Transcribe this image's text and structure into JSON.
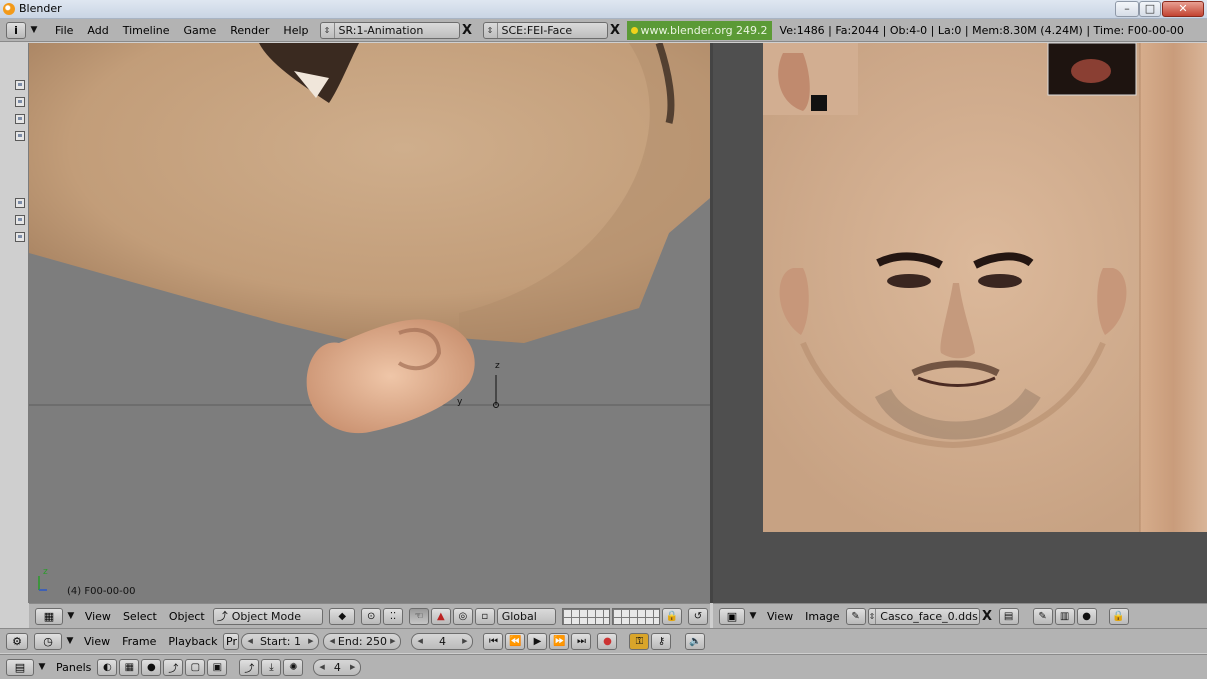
{
  "window": {
    "title": "Blender",
    "background_tabs": [
      "",
      "",
      "",
      "",
      ""
    ],
    "buttons": {
      "minimize": "–",
      "maximize": "□",
      "close": "✕"
    }
  },
  "header": {
    "info_icon": "i",
    "menus": [
      "File",
      "Add",
      "Timeline",
      "Game",
      "Render",
      "Help"
    ],
    "screen": "SR:1-Animation",
    "scene": "SCE:FEI-Face",
    "url": "www.blender.org 249.2",
    "stats": "Ve:1486 | Fa:2044 | Ob:4-0 | La:0  | Mem:8.30M (4.24M)  | Time: F00-00-00",
    "close_glyph": "X",
    "arrows_glyph": "⇕"
  },
  "viewport": {
    "frame_label": "(4) F00-00-00",
    "axis_z": "z",
    "axis_y": "y",
    "mini_axis_z": "z",
    "colors": {
      "background": "#7d7d7d",
      "skin": "#c8a581",
      "skin_dark": "#a5805f"
    }
  },
  "view3d_header": {
    "menus": [
      "View",
      "Select",
      "Object"
    ],
    "mode": "Object Mode",
    "orientation": "Global",
    "icons": [
      "grid-icon",
      "shading-icon",
      "pivot-icon",
      "hand-icon",
      "rotate-icon",
      "scale-icon",
      "lock-icon"
    ]
  },
  "image_header": {
    "menus": [
      "View",
      "Image"
    ],
    "image_name": "Casco_face_0.dds"
  },
  "timeline": {
    "menus": [
      "View",
      "Frame",
      "Playback"
    ],
    "pr_label": "Pr",
    "start_label": "Start: 1",
    "end_label": "End: 250",
    "current_frame": "4"
  },
  "buttons_window": {
    "panels_label": "Panels",
    "current_frame": "4"
  }
}
